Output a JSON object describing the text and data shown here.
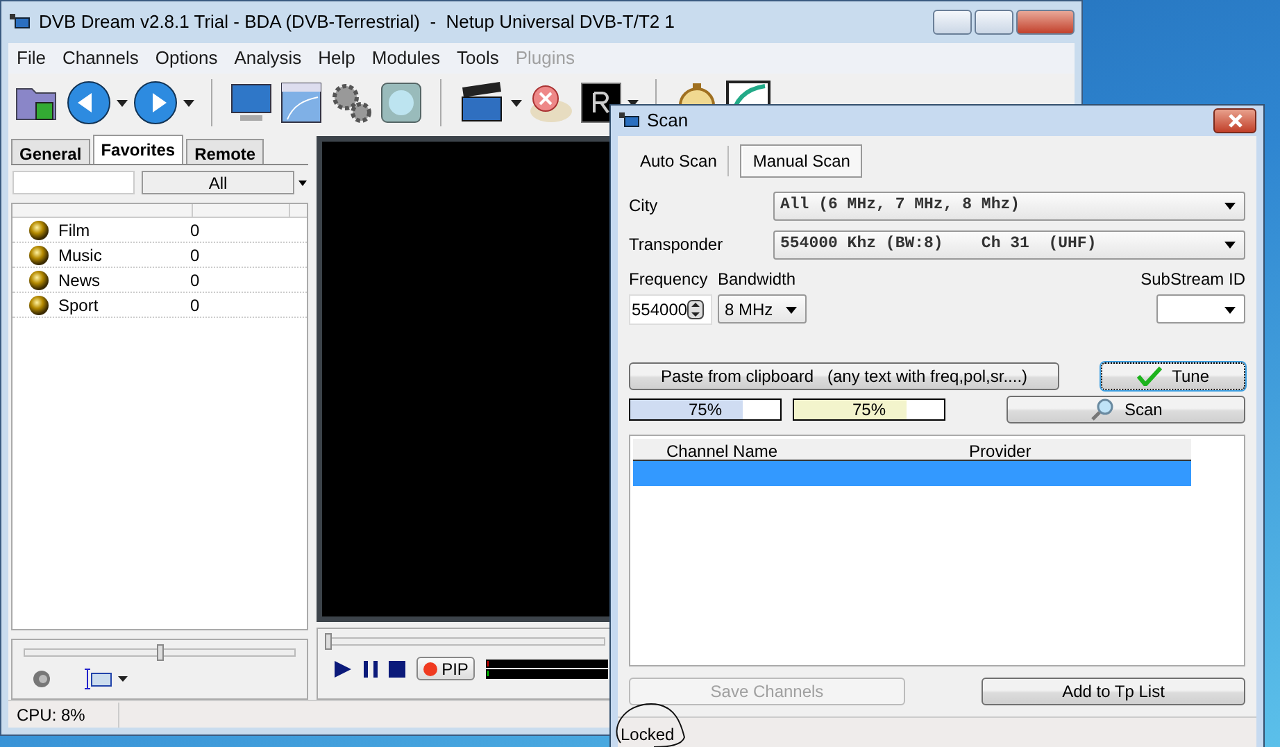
{
  "main_window": {
    "title": "DVB Dream v2.8.1 Trial - BDA (DVB-Terrestrial)  -  Netup Universal DVB-T/T2 1",
    "menu": [
      {
        "label": "File",
        "disabled": false
      },
      {
        "label": "Channels",
        "disabled": false
      },
      {
        "label": "Options",
        "disabled": false
      },
      {
        "label": "Analysis",
        "disabled": false
      },
      {
        "label": "Help",
        "disabled": false
      },
      {
        "label": "Modules",
        "disabled": false
      },
      {
        "label": "Tools",
        "disabled": false
      },
      {
        "label": "Plugins",
        "disabled": true
      }
    ],
    "side_tabs": [
      {
        "label": "General",
        "selected": false
      },
      {
        "label": "Favorites",
        "selected": true
      },
      {
        "label": "Remote",
        "selected": false
      }
    ],
    "filter": {
      "value": "All"
    },
    "favorites": [
      {
        "name": "Film",
        "count": "0"
      },
      {
        "name": "Music",
        "count": "0"
      },
      {
        "name": "News",
        "count": "0"
      },
      {
        "name": "Sport",
        "count": "0"
      }
    ],
    "volume": {
      "level": 0.5
    },
    "seek": {
      "level": 0
    },
    "pip_button": "PIP",
    "status_bar": {
      "cpu": "CPU: 8%"
    }
  },
  "scan_dialog": {
    "title": "Scan",
    "tabs": [
      {
        "label": "Auto Scan",
        "selected": false
      },
      {
        "label": "Manual Scan",
        "selected": true
      }
    ],
    "city": {
      "label": "City",
      "value": "All (6 MHz, 7 MHz, 8 Mhz)"
    },
    "transponder": {
      "label": "Transponder",
      "value": "554000 Khz (BW:8)    Ch 31  (UHF)"
    },
    "frequency": {
      "label": "Frequency",
      "value": "554000"
    },
    "bandwidth": {
      "label": "Bandwidth",
      "value": "8 MHz"
    },
    "substream": {
      "label": "SubStream ID"
    },
    "paste_button": "Paste from clipboard   (any text with freq,pol,sr....)",
    "tune_button": "Tune",
    "meters": [
      {
        "level": 0.75,
        "reading": "75%",
        "color": "#cfdcf2"
      },
      {
        "level": 0.75,
        "reading": "75%",
        "color": "#f3f4cc"
      }
    ],
    "scan_button": "Scan",
    "table": {
      "columns": [
        "Channel Name",
        "Provider"
      ],
      "rows": [
        {
          "selected": true
        }
      ]
    },
    "buttons": [
      {
        "label": "Save Channels",
        "disabled": true
      },
      {
        "label": "Add to Tp List",
        "disabled": false
      }
    ],
    "status": "Locked"
  }
}
